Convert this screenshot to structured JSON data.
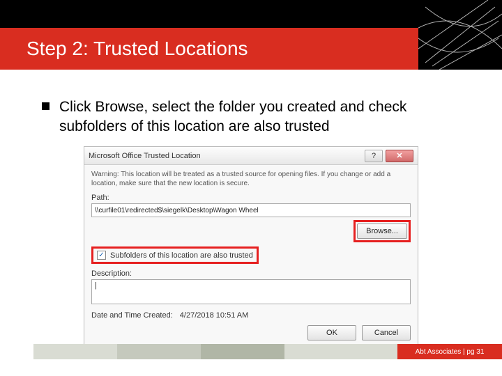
{
  "header": {
    "title": "Step 2: Trusted Locations"
  },
  "bullet": {
    "text": "Click Browse, select the folder you created and check subfolders of this location are also trusted"
  },
  "dialog": {
    "title": "Microsoft Office Trusted Location",
    "help": "?",
    "close": "✕",
    "warning": "Warning: This location will be treated as a trusted source for opening files. If you change or add a location, make sure that the new location is secure.",
    "path_label": "Path:",
    "path_value": "\\\\curfile01\\redirected$\\siegelk\\Desktop\\Wagon Wheel",
    "browse": "Browse...",
    "subfolders_label": "Subfolders of this location are also trusted",
    "description_label": "Description:",
    "description_value": "|",
    "date_label": "Date and Time Created:",
    "date_value": "4/27/2018 10:51 AM",
    "ok": "OK",
    "cancel": "Cancel"
  },
  "footer": {
    "text": "Abt Associates | pg 31"
  }
}
